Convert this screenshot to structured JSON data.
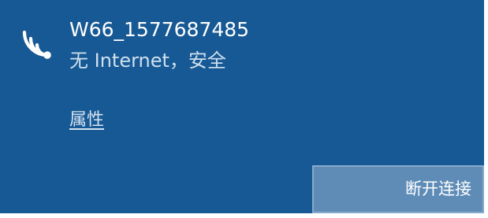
{
  "network": {
    "ssid": "W66_1577687485",
    "status": "无 Internet，安全",
    "icon": "wifi-signal-icon"
  },
  "actions": {
    "properties_label": "属性",
    "disconnect_label": "断开连接"
  },
  "colors": {
    "panel_background": "#175994",
    "button_background": "#5e8cb7",
    "text": "#ffffff"
  }
}
